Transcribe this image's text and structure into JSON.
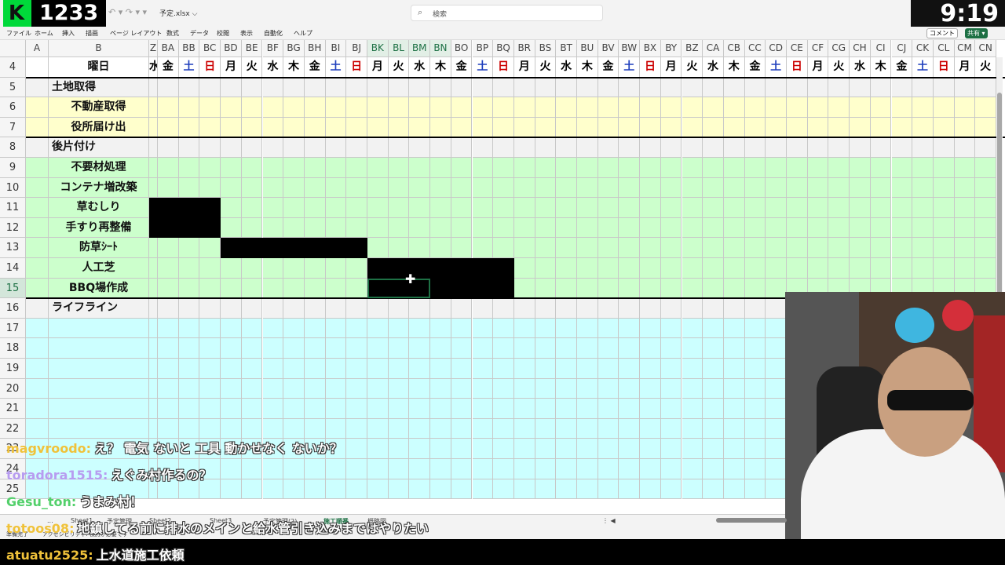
{
  "overlay": {
    "logo_letter": "K",
    "viewer_count": "1233",
    "clock": "9:19"
  },
  "titlebar": {
    "undo_redo": "↶ ▾  ↷ ▾  ▾",
    "filename": "予定.xlsx ⌵",
    "search_placeholder": "検索",
    "search_icon": "⌕"
  },
  "ribbon": {
    "tabs": [
      "ファイル",
      "ホーム",
      "挿入",
      "描画",
      "ページ レイアウト",
      "数式",
      "データ",
      "校閲",
      "表示",
      "自動化",
      "ヘルプ"
    ],
    "comment_label": "コメント",
    "share_label": "共有 ▾"
  },
  "sheet": {
    "col_b_header": "B",
    "col_a_header": "A",
    "hidden_partial_header": "Z",
    "column_headers": [
      "BA",
      "BB",
      "BC",
      "BD",
      "BE",
      "BF",
      "BG",
      "BH",
      "BI",
      "BJ",
      "BK",
      "BL",
      "BM",
      "BN",
      "BO",
      "BP",
      "BQ",
      "BR",
      "BS",
      "BT",
      "BU",
      "BV",
      "BW",
      "BX",
      "BY",
      "BZ",
      "CA",
      "CB",
      "CC",
      "CD",
      "CE",
      "CF",
      "CG",
      "CH",
      "CI",
      "CJ",
      "CK",
      "CL",
      "CM",
      "CN"
    ],
    "selected_columns": [
      "BK",
      "BL",
      "BM",
      "BN"
    ],
    "partial_day": "水",
    "days": [
      "金",
      "土",
      "日",
      "月",
      "火",
      "水",
      "木",
      "金",
      "土",
      "日",
      "月",
      "火",
      "水",
      "木",
      "金",
      "土",
      "日",
      "月",
      "火",
      "水",
      "木",
      "金",
      "土",
      "日",
      "月",
      "火",
      "水",
      "木",
      "金",
      "土",
      "日",
      "月",
      "火",
      "水",
      "木",
      "金",
      "土",
      "日",
      "月",
      "火"
    ],
    "rows": [
      {
        "num": "4",
        "label": "曜日"
      },
      {
        "num": "5",
        "label": "土地取得"
      },
      {
        "num": "6",
        "label": "不動産取得"
      },
      {
        "num": "7",
        "label": "役所届け出"
      },
      {
        "num": "8",
        "label": "後片付け"
      },
      {
        "num": "9",
        "label": "不要材処理"
      },
      {
        "num": "10",
        "label": "コンテナ増改築"
      },
      {
        "num": "11",
        "label": "草むしり"
      },
      {
        "num": "12",
        "label": "手すり再整備"
      },
      {
        "num": "13",
        "label": "防草ｼｰﾄ"
      },
      {
        "num": "14",
        "label": "人工芝"
      },
      {
        "num": "15",
        "label": "BBQ場作成"
      },
      {
        "num": "16",
        "label": "ライフライン"
      },
      {
        "num": "17",
        "label": ""
      },
      {
        "num": "18",
        "label": ""
      },
      {
        "num": "19",
        "label": ""
      },
      {
        "num": "20",
        "label": ""
      },
      {
        "num": "21",
        "label": ""
      },
      {
        "num": "22",
        "label": ""
      },
      {
        "num": "23",
        "label": ""
      },
      {
        "num": "24",
        "label": ""
      },
      {
        "num": "25",
        "label": ""
      }
    ],
    "selected_row": "15",
    "colors": {
      "section": "#f2f2f2",
      "yellow": "#ffffcc",
      "green": "#ccffcc",
      "cyan": "#ccffff",
      "saturday": "#1f3fbd",
      "sunday": "#cc0000",
      "selection": "#1e7145"
    }
  },
  "sheet_tabs": {
    "tabs": [
      "...",
      "Sheet1",
      "予定管理",
      "Sheet2",
      "Sheet3",
      "予定管理(2)",
      "施工順番",
      "概略図"
    ],
    "nav": "⋮  ◀"
  },
  "status": {
    "ready": "準備完了",
    "accessibility": "アクセシビリティ: 検討が必要です"
  },
  "chat": [
    {
      "user": "magvroodo:",
      "text": "え？ 電気 ないと 工具 動かせなく ないか？",
      "color": "#f0c23a"
    },
    {
      "user": "toradora1515:",
      "text": "えぐみ村作るの？",
      "color": "#b79cf0"
    },
    {
      "user": "Gesu_ton:",
      "text": "うまみ村！",
      "color": "#53d06b"
    },
    {
      "user": "totoos08:",
      "text": "地鎮してる前に排水のメインと給水管引き込みまではやりたい",
      "color": "#f0c23a"
    },
    {
      "user": "atuatu2525:",
      "text": "上水道施工依頼",
      "color": "#f0c23a"
    }
  ]
}
